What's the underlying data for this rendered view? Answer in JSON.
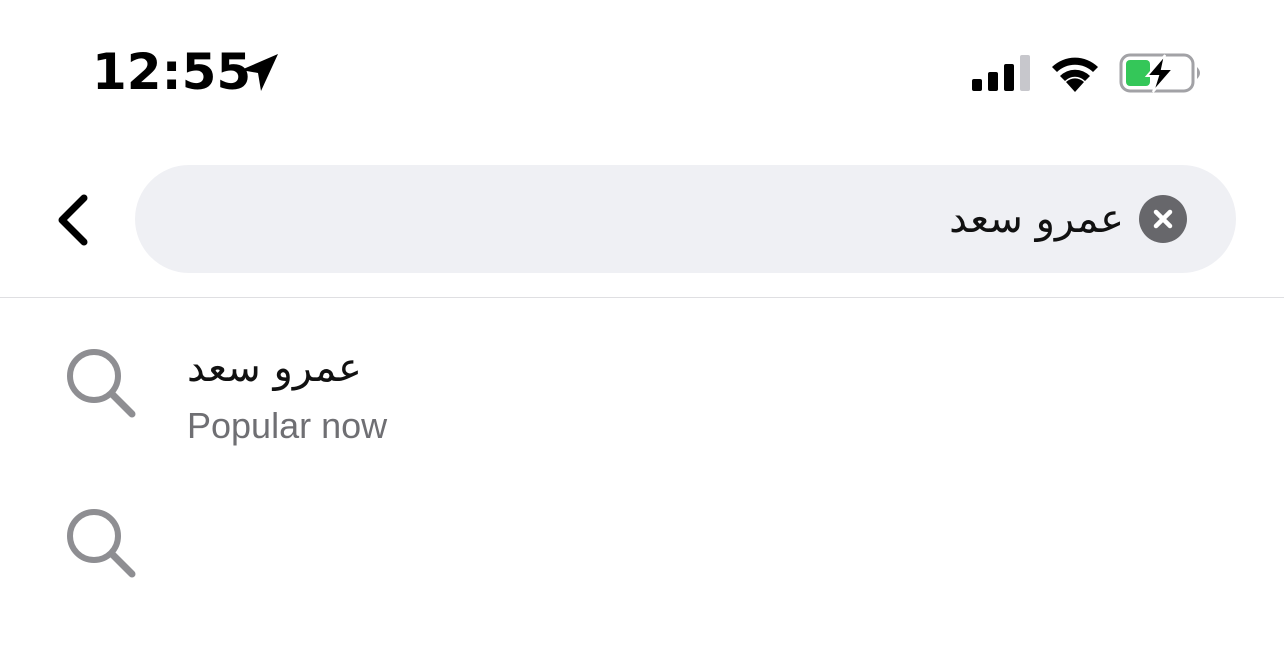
{
  "status_bar": {
    "time": "12:55",
    "icons": [
      "location-arrow-icon",
      "cellular-signal-icon",
      "wifi-icon",
      "battery-charging-icon"
    ],
    "battery_color": "#34c759"
  },
  "search": {
    "back_icon": "chevron-left-icon",
    "value": "عمرو سعد",
    "clear_icon": "clear-x-icon",
    "field_bg": "#eff0f4"
  },
  "results": [
    {
      "icon": "search-icon",
      "title": "عمرو سعد",
      "subtitle": "Popular now"
    },
    {
      "icon": "search-icon",
      "title": "",
      "subtitle": ""
    }
  ]
}
